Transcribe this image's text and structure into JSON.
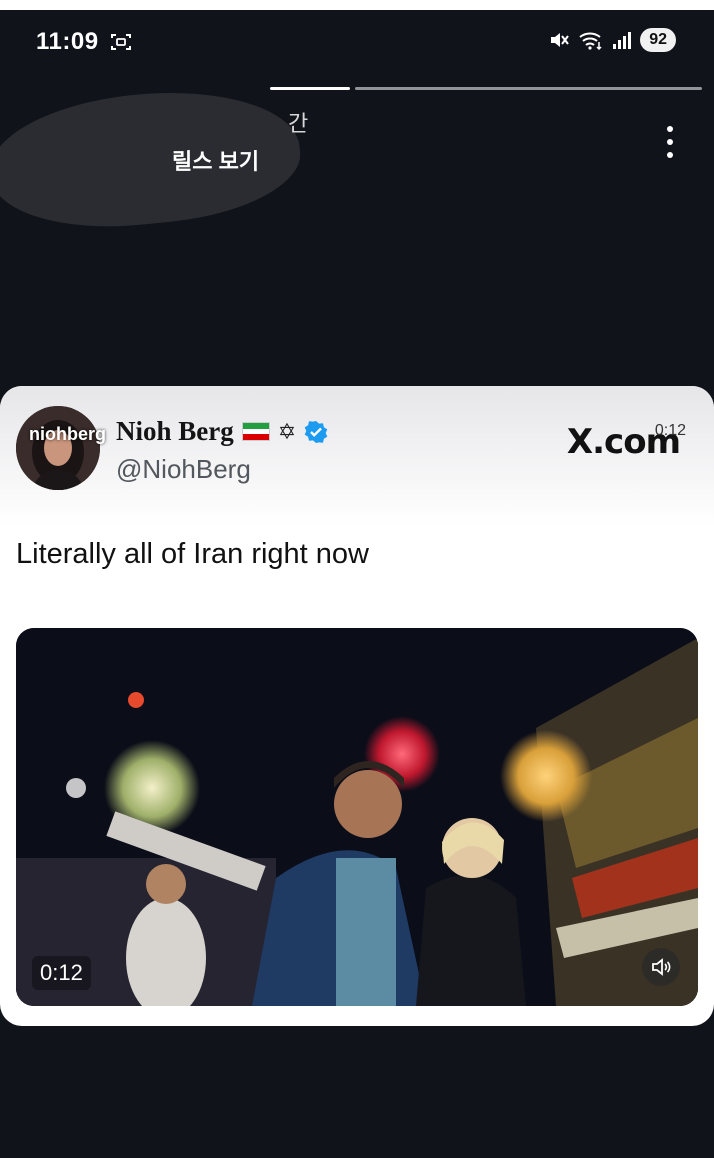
{
  "status_bar": {
    "time": "11:09",
    "battery": "92",
    "icons": [
      "screenshot-icon",
      "mute-icon",
      "wifi-icon",
      "signal-icon"
    ]
  },
  "story": {
    "time_label": "간",
    "subtitle": "릴스 보기",
    "progress_segments_total": 2,
    "progress_segments_done": 1
  },
  "tweet": {
    "avatar_overlay_text": "niohberg",
    "display_name": "Nioh Berg",
    "flag": "iran-flag",
    "symbol": "✡",
    "handle": "@NiohBerg",
    "source_logo": "X.com",
    "video_time_top": "0:12",
    "text": "Literally all of Iran right now"
  },
  "video": {
    "duration": "0:12",
    "controls": [
      "volume-icon"
    ]
  },
  "colors": {
    "background": "#10131a",
    "card": "#ffffff",
    "verified": "#1d9bf0",
    "flag_green": "#239f40",
    "flag_red": "#da0000"
  }
}
